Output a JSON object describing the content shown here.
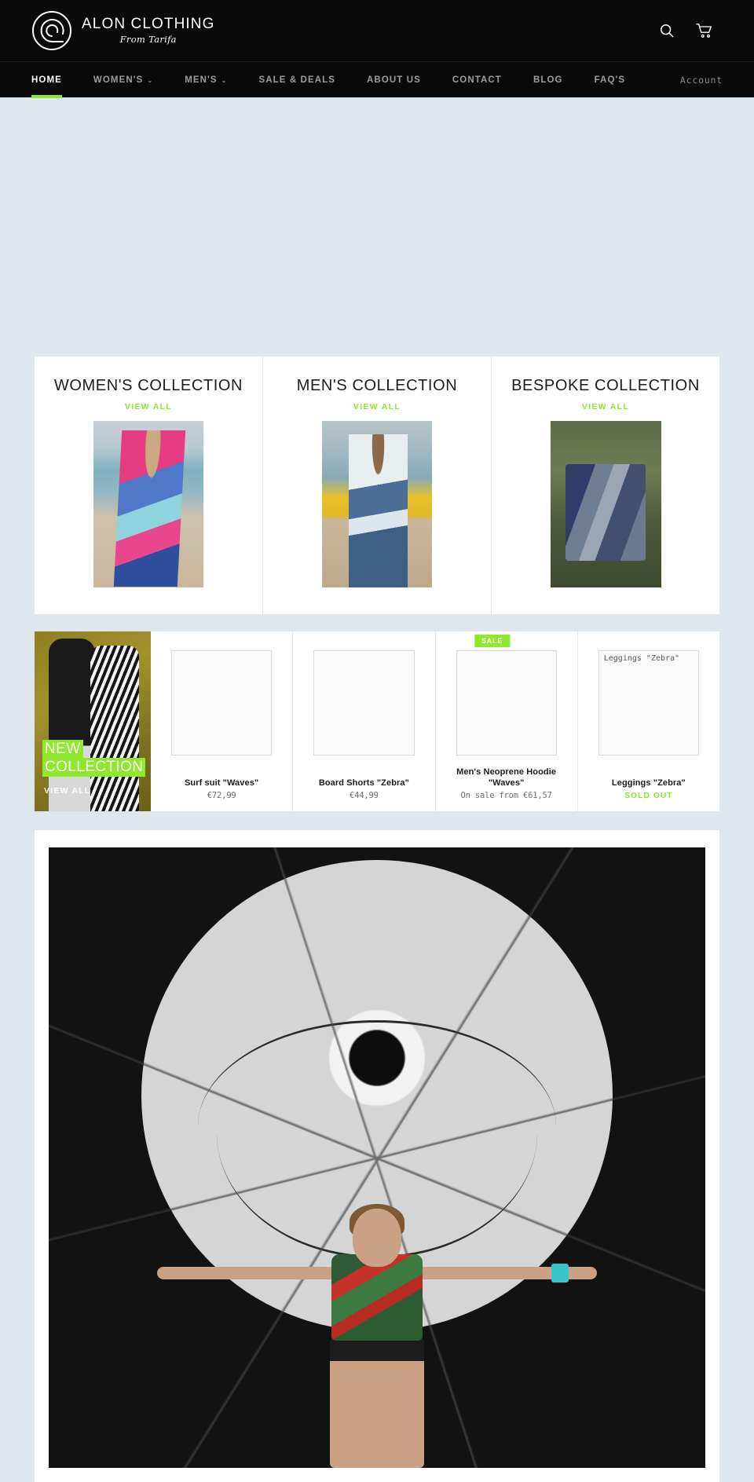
{
  "brand": {
    "name": "ALON CLOTHING",
    "tagline": "From Tarifa",
    "logo_icon": "spiral-wave-logo"
  },
  "header": {
    "search_icon": "search-icon",
    "cart_icon": "cart-icon"
  },
  "nav": {
    "items": [
      {
        "label": "HOME",
        "active": true,
        "has_dropdown": false
      },
      {
        "label": "WOMEN'S",
        "active": false,
        "has_dropdown": true
      },
      {
        "label": "MEN'S",
        "active": false,
        "has_dropdown": true
      },
      {
        "label": "SALE & DEALS",
        "active": false,
        "has_dropdown": false
      },
      {
        "label": "ABOUT US",
        "active": false,
        "has_dropdown": false
      },
      {
        "label": "CONTACT",
        "active": false,
        "has_dropdown": false
      },
      {
        "label": "BLOG",
        "active": false,
        "has_dropdown": false
      },
      {
        "label": "FAQ'S",
        "active": false,
        "has_dropdown": false
      }
    ],
    "account_label": "Account",
    "caret_glyph": "⌄"
  },
  "collections": [
    {
      "title": "WOMEN'S COLLECTION",
      "link_label": "VIEW ALL",
      "image_alt": "woman-with-surfboard-on-beach"
    },
    {
      "title": "MEN'S COLLECTION",
      "link_label": "VIEW ALL",
      "image_alt": "man-with-yellow-surfboard-on-beach"
    },
    {
      "title": "BESPOKE COLLECTION",
      "link_label": "VIEW ALL",
      "image_alt": "couple-on-forest-log"
    }
  ],
  "promo": {
    "line1": "NEW",
    "line2": "COLLECTION",
    "link_label": "VIEW ALL",
    "image_alt": "couple-in-black-and-zebra-outfits"
  },
  "products": [
    {
      "title": "Surf suit \"Waves\"",
      "price": "€72,99",
      "badge": null,
      "sold_out": false,
      "image_alt": ""
    },
    {
      "title": "Board Shorts \"Zebra\"",
      "price": "€44,99",
      "badge": null,
      "sold_out": false,
      "image_alt": ""
    },
    {
      "title": "Men's Neoprene Hoodie \"Waves\"",
      "price": "On sale from €61,57",
      "badge": "SALE",
      "sold_out": false,
      "image_alt": ""
    },
    {
      "title": "Leggings \"Zebra\"",
      "price": "SOLD OUT",
      "badge": null,
      "sold_out": true,
      "image_alt": "Leggings \"Zebra\""
    }
  ],
  "feature": {
    "image_alt": "woman-in-floral-sports-bra-in-front-of-moon-mural"
  },
  "colors": {
    "accent_green": "#8ee82b",
    "page_background": "#e0e6ed",
    "header_black": "#0a0a0a",
    "card_white": "#ffffff"
  }
}
